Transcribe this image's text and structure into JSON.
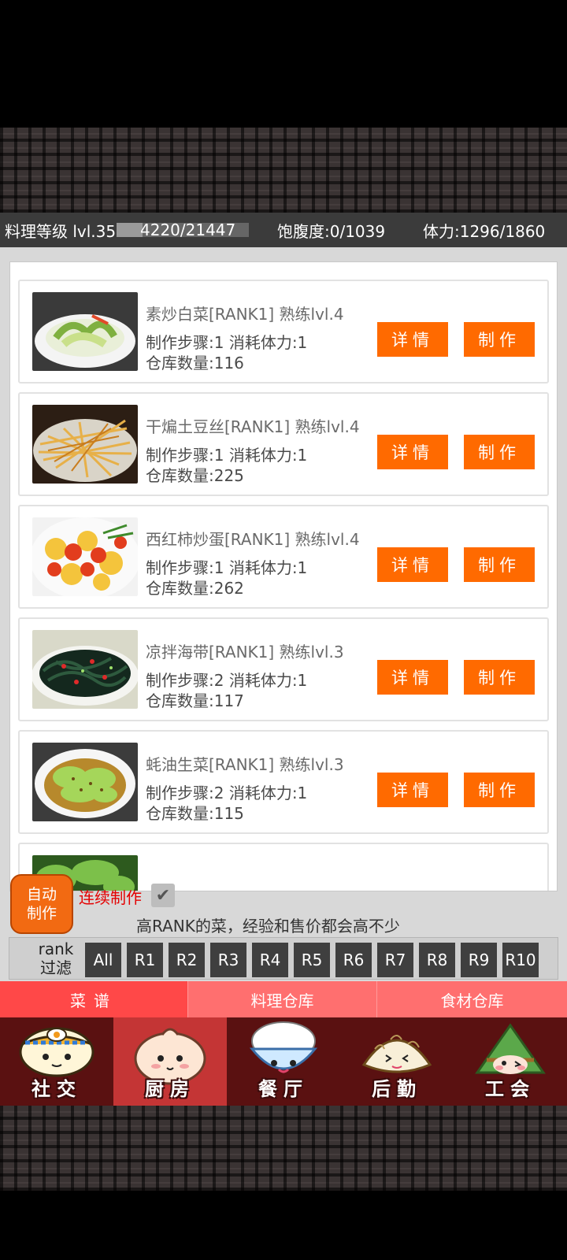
{
  "status": {
    "level_text": "料理等级 lvl.35",
    "exp_text": "4220/21447",
    "exp_fraction": 0.197,
    "hunger_text": "饱腹度:0/1039",
    "stamina_text": "体力:1296/1860"
  },
  "recipes": [
    {
      "name": "素炒白菜[RANK1]  熟练lvl.4",
      "steps": "制作步骤:1  消耗体力:1",
      "stock": "仓库数量:116",
      "detail_label": "详情",
      "make_label": "制作",
      "thumb": "cabbage"
    },
    {
      "name": "干煸土豆丝[RANK1]  熟练lvl.4",
      "steps": "制作步骤:1  消耗体力:1",
      "stock": "仓库数量:225",
      "detail_label": "详情",
      "make_label": "制作",
      "thumb": "potato"
    },
    {
      "name": "西红柿炒蛋[RANK1]  熟练lvl.4",
      "steps": "制作步骤:1  消耗体力:1",
      "stock": "仓库数量:262",
      "detail_label": "详情",
      "make_label": "制作",
      "thumb": "tomato-egg"
    },
    {
      "name": "凉拌海带[RANK1]  熟练lvl.3",
      "steps": "制作步骤:2  消耗体力:1",
      "stock": "仓库数量:117",
      "detail_label": "详情",
      "make_label": "制作",
      "thumb": "seaweed"
    },
    {
      "name": "蚝油生菜[RANK1]  熟练lvl.3",
      "steps": "制作步骤:2  消耗体力:1",
      "stock": "仓库数量:115",
      "detail_label": "详情",
      "make_label": "制作",
      "thumb": "lettuce"
    },
    {
      "name": "",
      "steps": "",
      "stock": "",
      "detail_label": "",
      "make_label": "",
      "thumb": "greens"
    }
  ],
  "controls": {
    "auto_make_line1": "自动",
    "auto_make_line2": "制作",
    "continuous_label": "连续制作",
    "continuous_checked": true,
    "hint": "高RANK的菜，经验和售价都会高不少"
  },
  "rank_filter": {
    "label_line1": "rank",
    "label_line2": "过滤",
    "options": [
      "All",
      "R1",
      "R2",
      "R3",
      "R4",
      "R5",
      "R6",
      "R7",
      "R8",
      "R9",
      "R10"
    ]
  },
  "tabs": [
    {
      "label": "菜谱",
      "active": true
    },
    {
      "label": "料理仓库",
      "active": false
    },
    {
      "label": "食材仓库",
      "active": false
    }
  ],
  "nav": [
    {
      "label": "社交",
      "icon": "noodle-bowl-icon",
      "active": false
    },
    {
      "label": "厨房",
      "icon": "bun-icon",
      "active": true
    },
    {
      "label": "餐厅",
      "icon": "rice-bowl-icon",
      "active": false
    },
    {
      "label": "后勤",
      "icon": "dumpling-icon",
      "active": false
    },
    {
      "label": "工会",
      "icon": "zongzi-icon",
      "active": false
    }
  ],
  "colors": {
    "accent_orange": "#ff6a00",
    "tab_active": "#ff4848",
    "tab_inactive": "#ff6f6f",
    "nav_bg": "#5a1111",
    "nav_active": "#c43535",
    "continuous_red": "#e40000"
  }
}
